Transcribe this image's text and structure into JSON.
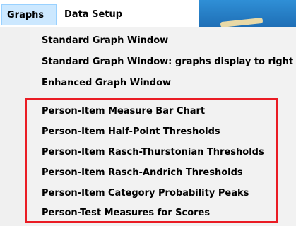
{
  "menubar": {
    "items": [
      {
        "label": "Graphs",
        "active": true
      },
      {
        "label": "Data Setup",
        "active": false
      }
    ]
  },
  "dropdown": {
    "items": [
      {
        "label": "Standard Graph Window"
      },
      {
        "label": "Standard Graph Window: graphs display to right"
      },
      {
        "label": "Enhanced Graph Window"
      },
      {
        "label": "Person-Item Measure Bar Chart"
      },
      {
        "label": "Person-Item Half-Point Thresholds"
      },
      {
        "label": "Person-Item Rasch-Thurstonian Thresholds"
      },
      {
        "label": "Person-Item Rasch-Andrich Thresholds"
      },
      {
        "label": "Person-Item Category Probability Peaks"
      },
      {
        "label": "Person-Test Measures for Scores"
      }
    ]
  },
  "colors": {
    "highlight_border": "#ea1c24",
    "active_menu_bg": "#cce8ff",
    "menu_bg": "#f2f2f2"
  }
}
